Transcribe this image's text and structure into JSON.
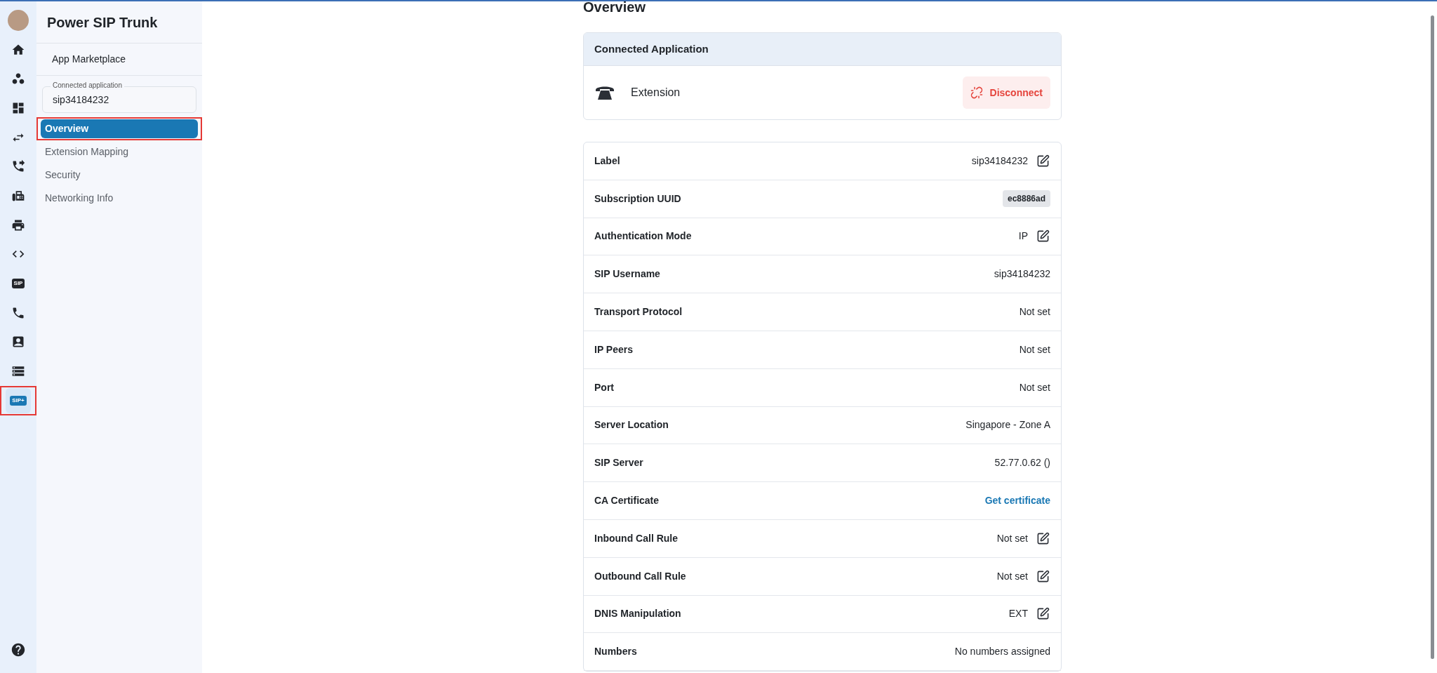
{
  "rail": [
    {
      "kind": "avatar",
      "selected": false,
      "highlighted": false
    },
    {
      "kind": "home",
      "selected": false,
      "highlighted": false
    },
    {
      "kind": "circles",
      "selected": false,
      "highlighted": false
    },
    {
      "kind": "dashboard",
      "selected": false,
      "highlighted": false
    },
    {
      "kind": "swap",
      "selected": false,
      "highlighted": false
    },
    {
      "kind": "call",
      "selected": false,
      "highlighted": false
    },
    {
      "kind": "fax",
      "selected": false,
      "highlighted": false
    },
    {
      "kind": "print",
      "selected": false,
      "highlighted": false
    },
    {
      "kind": "code",
      "selected": false,
      "highlighted": false
    },
    {
      "kind": "badge",
      "text": "SIP",
      "selected": false,
      "highlighted": false
    },
    {
      "kind": "phone",
      "selected": false,
      "highlighted": false
    },
    {
      "kind": "contact",
      "selected": false,
      "highlighted": false
    },
    {
      "kind": "storage",
      "selected": false,
      "highlighted": false
    },
    {
      "kind": "badge",
      "text": "SIP+",
      "selected": true,
      "highlighted": true
    }
  ],
  "sidebar": {
    "title": "Power SIP Trunk",
    "marketplace": "App Marketplace",
    "connected_field": {
      "label": "Connected application",
      "value": "sip34184232"
    },
    "items": [
      {
        "label": "Overview",
        "selected": true,
        "highlighted": true
      },
      {
        "label": "Extension Mapping",
        "selected": false,
        "highlighted": false
      },
      {
        "label": "Security",
        "selected": false,
        "highlighted": false
      },
      {
        "label": "Networking Info",
        "selected": false,
        "highlighted": false
      }
    ]
  },
  "page": {
    "title": "Overview",
    "connected_card": {
      "title": "Connected Application",
      "app": "Extension",
      "button": "Disconnect"
    },
    "rows": [
      {
        "label": "Label",
        "value": "sip34184232",
        "kind": "text",
        "editable": true
      },
      {
        "label": "Subscription UUID",
        "value": "ec8886ad",
        "kind": "badge",
        "editable": false
      },
      {
        "label": "Authentication Mode",
        "value": "IP",
        "kind": "text",
        "editable": true
      },
      {
        "label": "SIP Username",
        "value": "sip34184232",
        "kind": "text",
        "editable": false
      },
      {
        "label": "Transport Protocol",
        "value": "Not set",
        "kind": "text",
        "editable": false
      },
      {
        "label": "IP Peers",
        "value": "Not set",
        "kind": "text",
        "editable": false
      },
      {
        "label": "Port",
        "value": "Not set",
        "kind": "text",
        "editable": false
      },
      {
        "label": "Server Location",
        "value": "Singapore - Zone A",
        "kind": "text",
        "editable": false
      },
      {
        "label": "SIP Server",
        "value": "52.77.0.62 ()",
        "kind": "text",
        "editable": false
      },
      {
        "label": "CA Certificate",
        "value": "Get certificate",
        "kind": "link",
        "editable": false
      },
      {
        "label": "Inbound Call Rule",
        "value": "Not set",
        "kind": "text",
        "editable": true
      },
      {
        "label": "Outbound Call Rule",
        "value": "Not set",
        "kind": "text",
        "editable": true
      },
      {
        "label": "DNIS Manipulation",
        "value": "EXT",
        "kind": "text",
        "editable": true
      },
      {
        "label": "Numbers",
        "value": "No numbers assigned",
        "kind": "text",
        "editable": false
      }
    ]
  }
}
